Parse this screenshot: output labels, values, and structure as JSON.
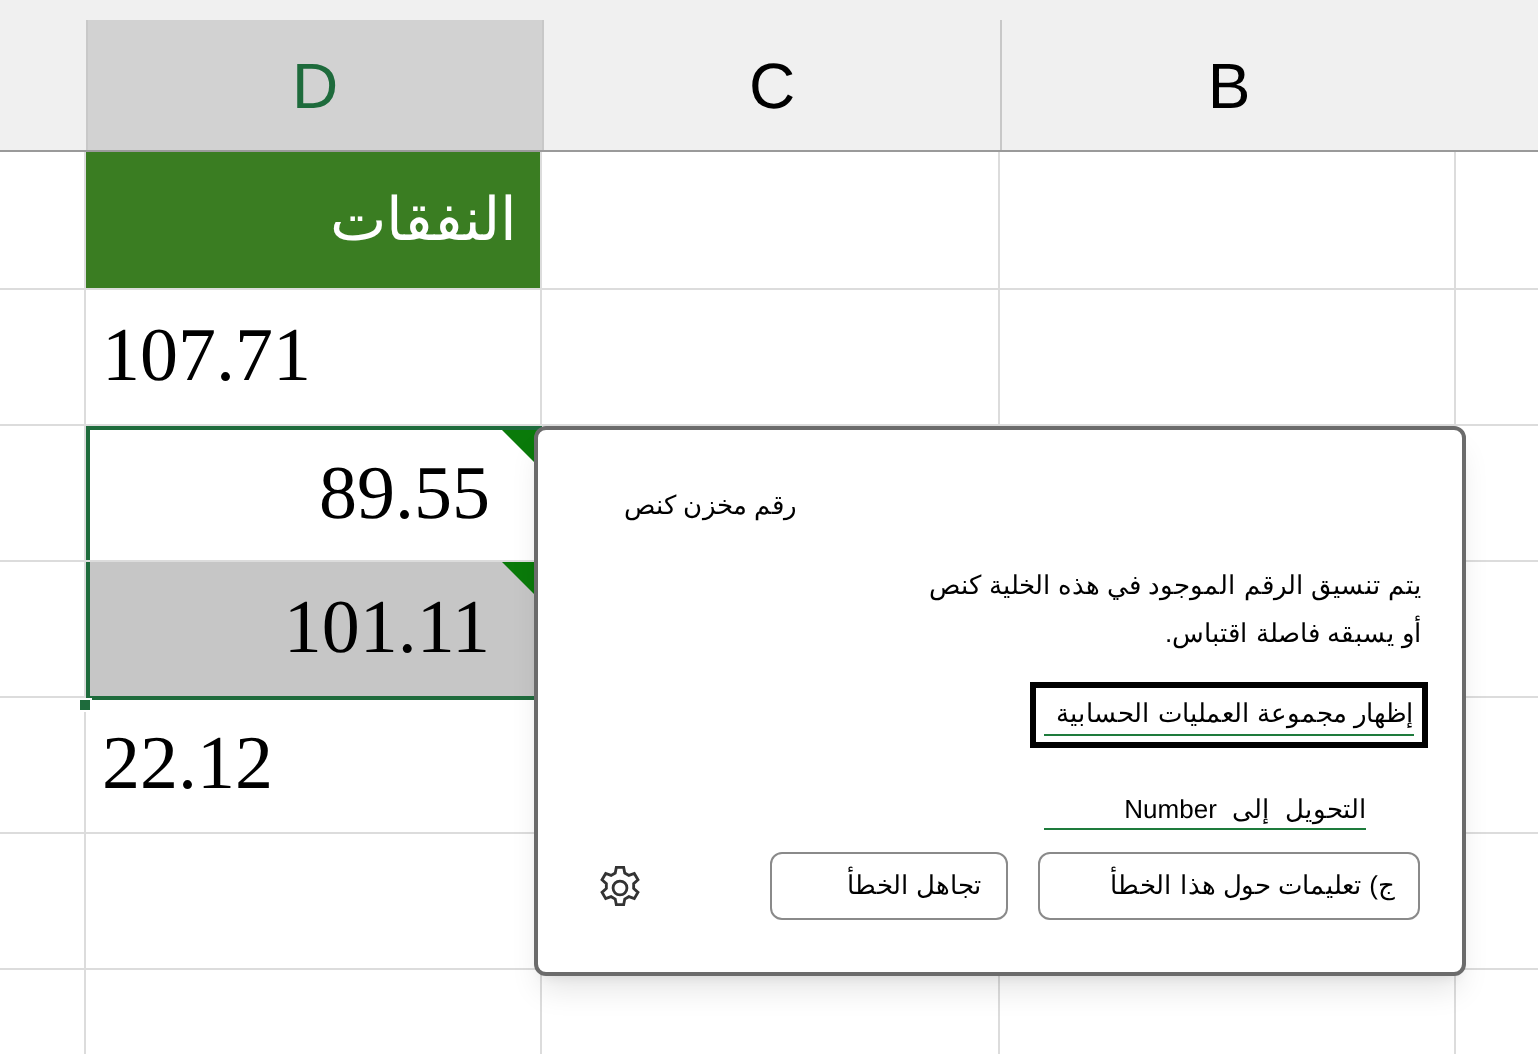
{
  "columns": [
    {
      "label": "B",
      "selected": false
    },
    {
      "label": "C",
      "selected": false
    },
    {
      "label": "D",
      "selected": true
    }
  ],
  "cells": [
    {
      "text": "النفقات",
      "kind": "header",
      "error": false,
      "in_selection": false,
      "selected": false
    },
    {
      "text": "107.71",
      "kind": "number",
      "error": false,
      "in_selection": false,
      "selected": false
    },
    {
      "text": "89.55",
      "kind": "number",
      "error": true,
      "in_selection": true,
      "selected": false
    },
    {
      "text": "101.11",
      "kind": "number",
      "error": true,
      "in_selection": true,
      "selected": true
    },
    {
      "text": "22.12",
      "kind": "number",
      "error": false,
      "in_selection": false,
      "selected": false
    }
  ],
  "popup": {
    "title": "رقم مخزن كنص",
    "message_lines": [
      "يتم تنسيق الرقم الموجود في هذه الخلية كنص",
      "أو يسبقه فاصلة اقتباس."
    ],
    "actions": [
      {
        "label": "إظهار مجموعة العمليات الحسابية",
        "focused": true
      },
      {
        "label": "التحويل إلى Number",
        "focused": false
      }
    ],
    "buttons": [
      "ج) تعليمات حول هذا الخطأ",
      "تجاهل الخطأ"
    ]
  }
}
